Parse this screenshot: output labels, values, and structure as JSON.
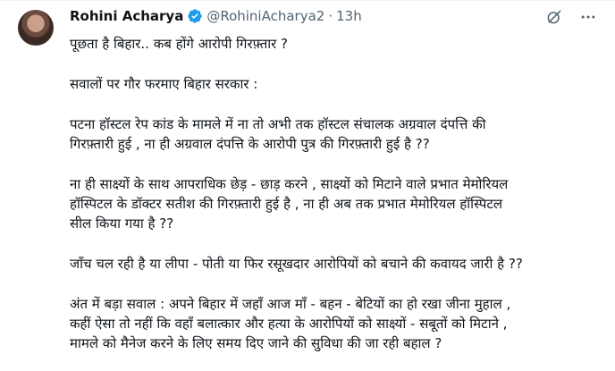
{
  "author": {
    "name": "Rohini Acharya",
    "handle": "@RohiniAcharya2",
    "separator": "·",
    "time": "13h"
  },
  "icons": {
    "avatar": "profile-photo",
    "verified": "verified-badge-icon",
    "grok": "grok-icon",
    "more": "more-icon"
  },
  "colors": {
    "verified": "#1d9bf0",
    "text": "#0f1419",
    "secondary": "#536471"
  },
  "tweet": {
    "paragraphs": [
      [
        "पूछता है बिहार.. कब होंगे आरोपी गिरफ़्तार ?"
      ],
      [
        "सवालों पर गौर फरमाए बिहार सरकार :"
      ],
      [
        "पटना हॉस्टल रेप कांड के मामले में ना तो अभी तक हॉस्टल संचालक अग्रवाल दंपत्ति की",
        "गिरफ़्तारी हुई , ना ही अग्रवाल दंपत्ति के आरोपी पुत्र की गिरफ़्तारी हुई है ??"
      ],
      [
        "ना ही साक्ष्यों के साथ आपराधिक छेड़ - छाड़ करने , साक्ष्यों को मिटाने वाले प्रभात मेमोरियल",
        "हॉस्पिटल के डॉक्टर सतीश की गिरफ़्तारी हुई है , ना ही अब तक प्रभात मेमोरियल हॉस्पिटल",
        "सील किया गया है ??"
      ],
      [
        "जाँच चल रही है या लीपा - पोती या फिर रसूखदार  आरोपियों को बचाने की कवायद जारी है ??"
      ],
      [
        "अंत में बड़ा सवाल  : अपने  बिहार में जहाँ आज माँ - बहन - बेटियों का हो रखा जीना मुहाल ,",
        "कहीं ऐसा तो नहीं कि वहाँ बलात्कार और हत्या के आरोपियों को साक्ष्यों - सबूतों को मिटाने ,",
        "मामले को मैनेज करने के लिए समय दिए जाने की सुविधा की जा रही बहाल ?"
      ]
    ]
  }
}
